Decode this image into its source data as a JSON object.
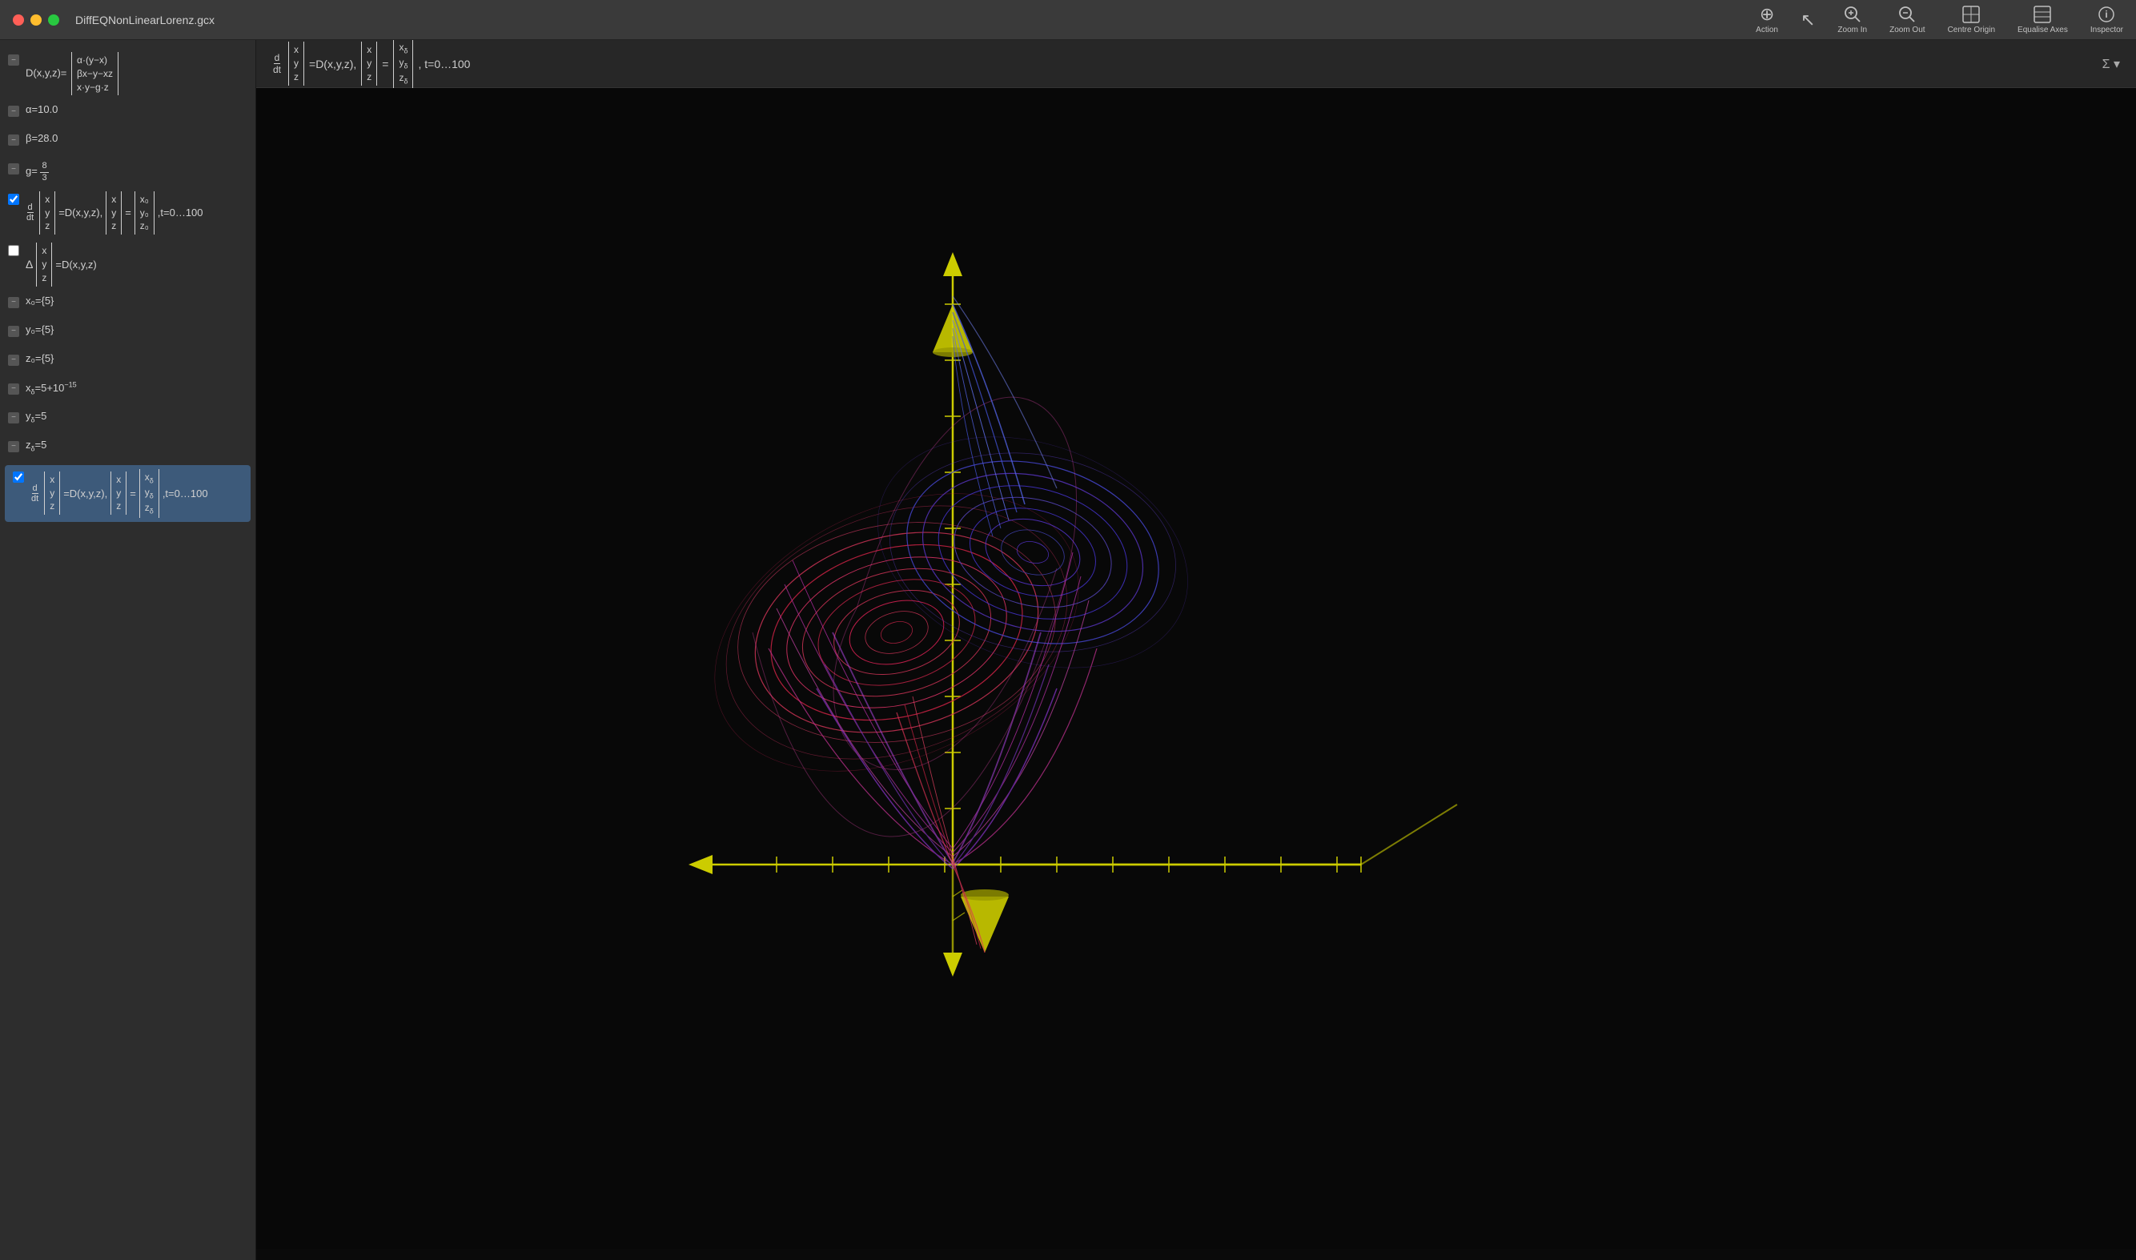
{
  "app": {
    "title": "DiffEQNonLinearLorenz.gcx",
    "traffic_lights": [
      "red",
      "yellow",
      "green"
    ]
  },
  "toolbar": {
    "items": [
      {
        "id": "action",
        "label": "Action",
        "icon": "⊕"
      },
      {
        "id": "pointer",
        "label": "",
        "icon": "↖"
      },
      {
        "id": "zoom-in",
        "label": "Zoom In",
        "icon": "⊕"
      },
      {
        "id": "zoom-out",
        "label": "Zoom Out",
        "icon": "⊖"
      },
      {
        "id": "centre-origin",
        "label": "Centre Origin",
        "icon": "⊞"
      },
      {
        "id": "equalise-axes",
        "label": "Equalise Axes",
        "icon": "⊟"
      },
      {
        "id": "inspector",
        "label": "Inspector",
        "icon": "ⓘ"
      }
    ]
  },
  "sidebar": {
    "items": [
      {
        "id": "item-D",
        "type": "minus",
        "checked": false,
        "math": "D_def"
      },
      {
        "id": "item-alpha",
        "type": "minus",
        "checked": false,
        "text": "α=10.0"
      },
      {
        "id": "item-beta",
        "type": "minus",
        "checked": false,
        "text": "β=28.0"
      },
      {
        "id": "item-g",
        "type": "minus",
        "checked": false,
        "text": "g_frac"
      },
      {
        "id": "item-ode1",
        "type": "checkbox",
        "checked": true,
        "math": "ode1"
      },
      {
        "id": "item-delta",
        "type": "checkbox",
        "checked": false,
        "math": "delta"
      },
      {
        "id": "item-x0",
        "type": "minus",
        "checked": false,
        "text": "x₀={5}"
      },
      {
        "id": "item-y0",
        "type": "minus",
        "checked": false,
        "text": "y₀={5}"
      },
      {
        "id": "item-z0",
        "type": "minus",
        "checked": false,
        "text": "z₀={5}"
      },
      {
        "id": "item-xd",
        "type": "minus",
        "checked": false,
        "text": "xd_eq"
      },
      {
        "id": "item-yd",
        "type": "minus",
        "checked": false,
        "text": "yδ=5"
      },
      {
        "id": "item-zd",
        "type": "minus",
        "checked": false,
        "text": "zδ=5"
      },
      {
        "id": "item-ode2",
        "type": "checkbox",
        "checked": true,
        "math": "ode2",
        "selected": true
      }
    ]
  },
  "canvas": {
    "equation_bar": "d/dt [x y z] = D(x,y,z), [x y z] = [xδ yδ zδ], t=0…100",
    "sigma_label": "Σ ▾"
  },
  "colors": {
    "background": "#0a0a0a",
    "axes": "#cccc00",
    "lorenz_red": "#cc2244",
    "lorenz_blue": "#4444cc",
    "lorenz_purple": "#8833cc"
  }
}
